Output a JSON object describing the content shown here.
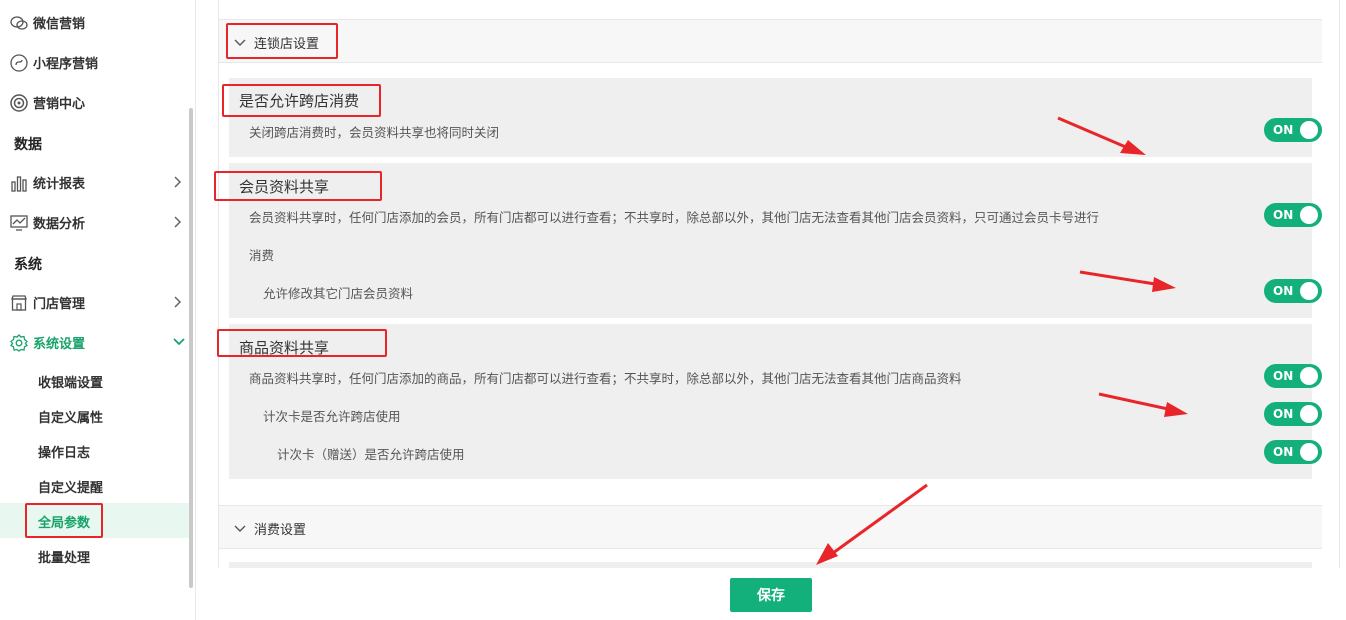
{
  "sidebar": {
    "items": [
      {
        "label": "微信营销",
        "icon": "wechat-icon"
      },
      {
        "label": "小程序营销",
        "icon": "miniprogram-icon"
      },
      {
        "label": "营销中心",
        "icon": "target-icon"
      },
      {
        "label": "数据"
      },
      {
        "label": "统计报表",
        "icon": "bar-chart-icon"
      },
      {
        "label": "数据分析",
        "icon": "line-chart-icon"
      },
      {
        "label": "系统"
      },
      {
        "label": "门店管理",
        "icon": "store-icon"
      },
      {
        "label": "系统设置",
        "icon": "gear-icon"
      }
    ],
    "sub_items": [
      "收银端设置",
      "自定义属性",
      "操作日志",
      "自定义提醒",
      "全局参数",
      "批量处理"
    ],
    "active_sub": "全局参数",
    "accent_color": "#18a36b"
  },
  "chain_section": {
    "title": "连锁店设置",
    "cross_store": {
      "title": "是否允许跨店消费",
      "desc": "关闭跨店消费时，会员资料共享也将同时关闭",
      "toggle": "ON"
    },
    "member_share": {
      "title": "会员资料共享",
      "desc_line1": "会员资料共享时，任何门店添加的会员，所有门店都可以进行查看；不共享时，除总部以外，其他门店无法查看其他门店会员资料，只可通过会员卡号进行",
      "desc_line2": "消费",
      "toggle": "ON",
      "sub_option": "允许修改其它门店会员资料",
      "sub_toggle": "ON"
    },
    "product_share": {
      "title": "商品资料共享",
      "desc": "商品资料共享时，任何门店添加的商品，所有门店都可以进行查看；不共享时，除总部以外，其他门店无法查看其他门店商品资料",
      "toggle": "ON",
      "sub_option1": "计次卡是否允许跨店使用",
      "sub_toggle1": "ON",
      "sub_option2": "计次卡（赠送）是否允许跨店使用",
      "sub_toggle2": "ON"
    }
  },
  "consume_section": {
    "title": "消费设置"
  },
  "save_label": "保存",
  "toggle_color": "#13b07c",
  "annotation_color": "#e8262a"
}
